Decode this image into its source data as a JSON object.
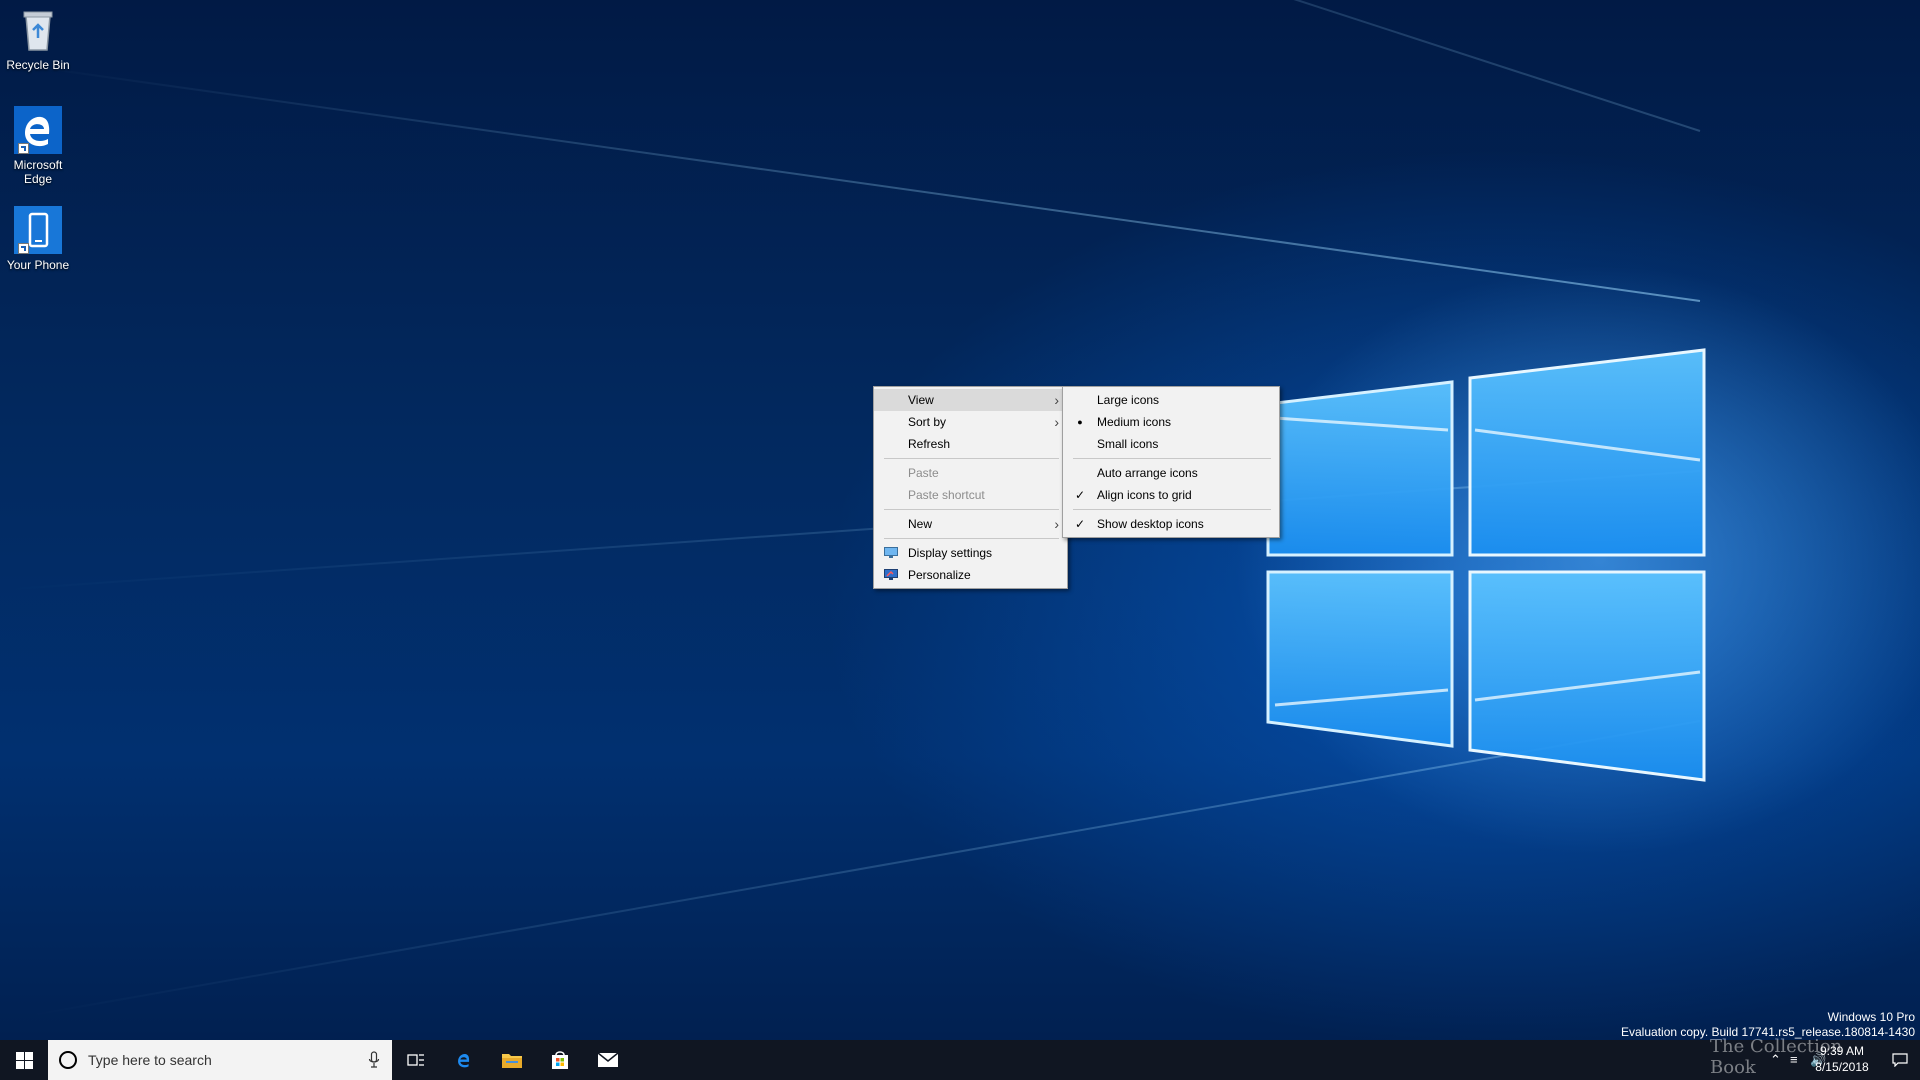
{
  "desktop": {
    "icons": [
      {
        "label": "Recycle Bin",
        "icon": "recycle-bin-icon"
      },
      {
        "label": "Microsoft Edge",
        "icon": "edge-icon"
      },
      {
        "label": "Your Phone",
        "icon": "phone-icon"
      }
    ],
    "watermark": {
      "edition": "Windows 10 Pro",
      "build": "Evaluation copy. Build 17741.rs5_release.180814-1430"
    }
  },
  "context_menu": {
    "items": [
      {
        "label": "View",
        "has_submenu": true,
        "highlighted": true
      },
      {
        "label": "Sort by",
        "has_submenu": true
      },
      {
        "label": "Refresh"
      },
      {
        "label": "Paste",
        "disabled": true
      },
      {
        "label": "Paste shortcut",
        "disabled": true
      },
      {
        "label": "New",
        "has_submenu": true
      },
      {
        "label": "Display settings",
        "icon": "display-settings-icon"
      },
      {
        "label": "Personalize",
        "icon": "personalize-icon"
      }
    ]
  },
  "view_submenu": {
    "items": [
      {
        "label": "Large icons"
      },
      {
        "label": "Medium icons",
        "selected": true
      },
      {
        "label": "Small icons"
      },
      {
        "label": "Auto arrange icons"
      },
      {
        "label": "Align icons to grid",
        "checked": true
      },
      {
        "label": "Show desktop icons",
        "checked": true
      }
    ],
    "bullet": "●",
    "check": "✓"
  },
  "taskbar": {
    "search_placeholder": "Type here to search",
    "pinned": [
      "task-view-icon",
      "edge-icon",
      "file-explorer-icon",
      "store-icon",
      "mail-icon"
    ],
    "clock": {
      "time": "9:39 AM",
      "date": "8/15/2018"
    },
    "tray_watermark": "The Collection Book"
  },
  "colors": {
    "accent": "#0078d7",
    "taskbar": "#101622",
    "menu_bg": "#f2f2f2",
    "menu_highlight": "#dadada"
  }
}
